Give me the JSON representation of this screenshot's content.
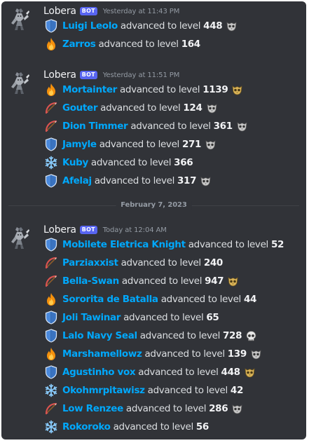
{
  "groups": [
    {
      "author": "Lobera",
      "bot_tag": "BOT",
      "timestamp": "Yesterday at 11:43 PM",
      "messages": [
        {
          "icon": "shield-icon",
          "name": "Luigi Leolo",
          "text": "advanced to level",
          "level": "448",
          "badge": "owl-skull-badge"
        },
        {
          "icon": "fire-icon",
          "name": "Zarros",
          "text": "advanced to level",
          "level": "164",
          "badge": ""
        }
      ]
    },
    {
      "author": "Lobera",
      "bot_tag": "BOT",
      "timestamp": "Yesterday at 11:51 PM",
      "messages": [
        {
          "icon": "fire-icon",
          "name": "Mortainter",
          "text": "advanced to level",
          "level": "1139",
          "badge": "gold-owl-badge"
        },
        {
          "icon": "bow-icon",
          "name": "Gouter",
          "text": "advanced to level",
          "level": "124",
          "badge": "owl-skull-badge"
        },
        {
          "icon": "bow-icon",
          "name": "Dion Timmer",
          "text": "advanced to level",
          "level": "361",
          "badge": "owl-skull-badge"
        },
        {
          "icon": "shield-icon",
          "name": "Jamyle",
          "text": "advanced to level",
          "level": "271",
          "badge": "owl-skull-badge"
        },
        {
          "icon": "snowflake-icon",
          "name": "Kuby",
          "text": "advanced to level",
          "level": "366",
          "badge": ""
        },
        {
          "icon": "shield-icon",
          "name": "Afelaj",
          "text": "advanced to level",
          "level": "317",
          "badge": "owl-skull-badge"
        }
      ]
    },
    {
      "author": "Lobera",
      "bot_tag": "BOT",
      "timestamp": "Today at 12:04 AM",
      "messages": [
        {
          "icon": "shield-icon",
          "name": "Mobilete Eletrica Knight",
          "text": "advanced to level",
          "level": "52",
          "badge": ""
        },
        {
          "icon": "bow-icon",
          "name": "Parziaxxist",
          "text": "advanced to level",
          "level": "240",
          "badge": ""
        },
        {
          "icon": "bow-icon",
          "name": "Bella-Swan",
          "text": "advanced to level",
          "level": "947",
          "badge": "gold-owl-badge"
        },
        {
          "icon": "fire-icon",
          "name": "Sororita de Batalla",
          "text": "advanced to level",
          "level": "44",
          "badge": ""
        },
        {
          "icon": "shield-icon",
          "name": "Joli Tawinar",
          "text": "advanced to level",
          "level": "65",
          "badge": ""
        },
        {
          "icon": "shield-icon",
          "name": "Lalo Navy Seal",
          "text": "advanced to level",
          "level": "728",
          "badge": "skull-badge"
        },
        {
          "icon": "fire-icon",
          "name": "Marshamellowz",
          "text": "advanced to level",
          "level": "139",
          "badge": "owl-skull-badge"
        },
        {
          "icon": "shield-icon",
          "name": "Agustinho vox",
          "text": "advanced to level",
          "level": "448",
          "badge": "gold-owl-badge"
        },
        {
          "icon": "snowflake-icon",
          "name": "Okohmrpitawisz",
          "text": "advanced to level",
          "level": "42",
          "badge": ""
        },
        {
          "icon": "bow-icon",
          "name": "Low Renzee",
          "text": "advanced to level",
          "level": "286",
          "badge": "owl-skull-badge"
        },
        {
          "icon": "snowflake-icon",
          "name": "Rokoroko",
          "text": "advanced to level",
          "level": "56",
          "badge": ""
        }
      ]
    }
  ],
  "date_divider": "February 7, 2023",
  "colors": {
    "background": "#313338",
    "username": "#00a8fc",
    "text": "#dbdee1",
    "bot_tag": "#5865f2",
    "muted": "#949ba4"
  }
}
